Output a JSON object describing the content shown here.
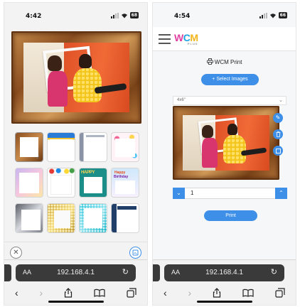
{
  "screen1": {
    "status": {
      "time": "4:42",
      "battery": "68"
    },
    "thumbnails": [
      {
        "style": "wood",
        "selected": true
      },
      {
        "style": "blue-corner"
      },
      {
        "style": "silver-stripe"
      },
      {
        "style": "colorful-dots"
      },
      {
        "style": "pastel"
      },
      {
        "style": "balloons"
      },
      {
        "style": "teal-happy"
      },
      {
        "style": "birthday-blue"
      },
      {
        "style": "silver-corner"
      },
      {
        "style": "gold-glitter"
      },
      {
        "style": "teal-glitter"
      },
      {
        "style": "navy-corner"
      }
    ],
    "url": "192.168.4.1",
    "aa_label": "AA"
  },
  "screen2": {
    "status": {
      "time": "4:54",
      "battery": "66"
    },
    "logo": {
      "w": "W",
      "c": "C",
      "m": "M",
      "plus": "PLUS"
    },
    "title": "WCM Print",
    "select_images": "+ Select Images",
    "size_option": "4x6\"",
    "quantity": "1",
    "print_label": "Print",
    "url": "192.168.4.1",
    "aa_label": "AA"
  },
  "colors": {
    "accent": "#3d8fe8",
    "dark_urlbar": "#3a3a3a"
  }
}
